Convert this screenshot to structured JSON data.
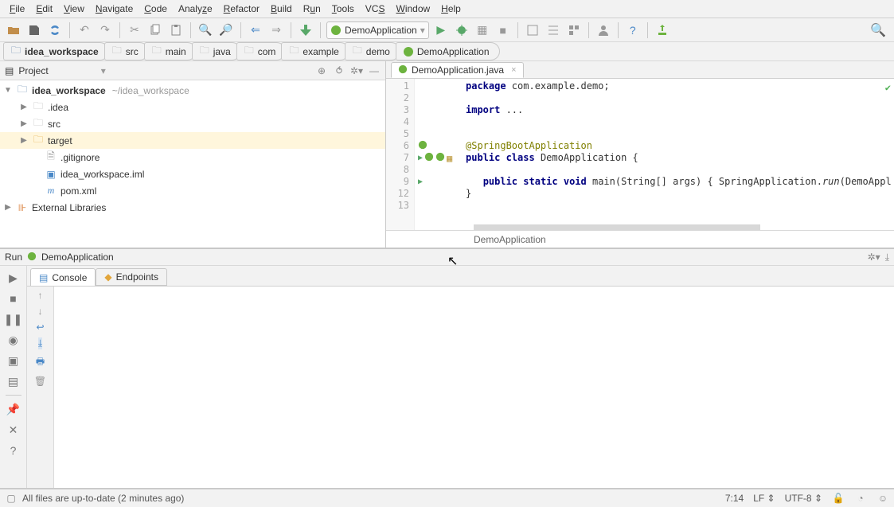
{
  "menu": [
    "File",
    "Edit",
    "View",
    "Navigate",
    "Code",
    "Analyze",
    "Refactor",
    "Build",
    "Run",
    "Tools",
    "VCS",
    "Window",
    "Help"
  ],
  "run_config": "DemoApplication",
  "breadcrumb": [
    "idea_workspace",
    "src",
    "main",
    "java",
    "com",
    "example",
    "demo",
    "DemoApplication"
  ],
  "project_pane_title": "Project",
  "tree": {
    "root": {
      "name": "idea_workspace",
      "path": "~/idea_workspace"
    },
    "children": [
      ".idea",
      "src",
      "target",
      ".gitignore",
      "idea_workspace.iml",
      "pom.xml"
    ],
    "ext": "External Libraries"
  },
  "editor": {
    "tab": "DemoApplication.java",
    "line_numbers": [
      1,
      2,
      3,
      4,
      5,
      6,
      7,
      8,
      9,
      12,
      13
    ],
    "code_pkg": "package ",
    "code_pkg2": "com.example.demo;",
    "code_import": "import ",
    "code_ell": "...",
    "code_ann": "@SpringBootApplication",
    "code_pub": "public ",
    "code_class": "class ",
    "code_cls_name": "DemoApplication {",
    "code_pub2": "public ",
    "code_static": "static ",
    "code_void": "void ",
    "code_main": "main(String[] args) { SpringApplication.",
    "code_run": "run",
    "code_tail": "(DemoAppl",
    "code_close": "}",
    "crumb": "DemoApplication"
  },
  "run_tool": {
    "title_prefix": "Run",
    "title_name": "DemoApplication",
    "tab_console": "Console",
    "tab_endpoints": "Endpoints"
  },
  "status": {
    "msg": "All files are up-to-date (2 minutes ago)",
    "pos": "7:14",
    "le": "LF",
    "enc": "UTF-8"
  }
}
